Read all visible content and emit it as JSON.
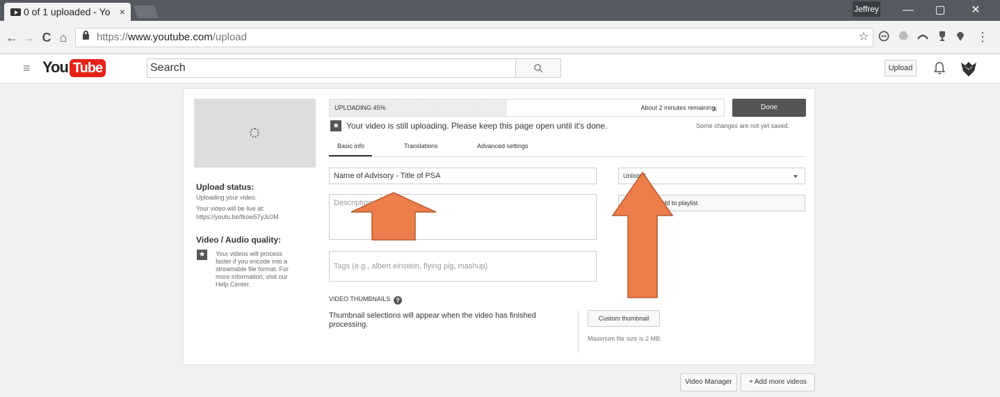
{
  "browser": {
    "tab_title": "0 of 1 uploaded - Yo",
    "tab_close": "×",
    "user_name": "Jeffrey",
    "url_prefix": "https://",
    "url_host": "www.youtube.com",
    "url_path": "/upload",
    "minimize": "—",
    "maximize": "▢",
    "close": "✕",
    "back": "←",
    "forward": "→",
    "reload": "C",
    "home": "⌂",
    "bookmark": "☆",
    "menu": "⋮"
  },
  "header": {
    "logo_you": "You",
    "logo_tube": "Tube",
    "search_value": "Search",
    "upload_label": "Upload"
  },
  "upload": {
    "progress_label": "UPLOADING 45%",
    "progress_fraction": 0.45,
    "remaining": "About 2 minutes remaining.",
    "cancel": "×",
    "done_label": "Done",
    "still_uploading": "Your video is still uploading. Please keep this page open until it's done.",
    "not_saved": "Some changes are not yet saved.",
    "tabs": [
      "Basic info",
      "Translations",
      "Advanced settings"
    ],
    "title_value": "Name of Advisory - Title of PSA",
    "privacy_value": "Unlisted",
    "description_placeholder": "Description",
    "playlist_label": "+ Add to playlist",
    "tags_placeholder": "Tags (e.g., albert einstein, flying pig, mashup)",
    "thumbnails_heading": "VIDEO THUMBNAILS",
    "thumbnails_help": "?",
    "thumbnails_text": "Thumbnail selections will appear when the video has finished processing.",
    "custom_thumbnail_label": "Custom thumbnail",
    "max_file_size": "Maximum file size is 2 MB."
  },
  "sidebar": {
    "status_heading": "Upload status:",
    "status_line1": "Uploading your video.",
    "status_line2": "Your video will be live at:",
    "status_link": "https://youtu.be/tkow57yJc0M",
    "quality_heading": "Video / Audio quality:",
    "quality_text": "Your videos will process faster if you encode into a streamable file format. For more information, visit our Help Center."
  },
  "footer": {
    "video_manager": "Video Manager",
    "add_more": "+ Add more videos"
  },
  "colors": {
    "arrow_fill": "#ed7d4b",
    "arrow_stroke": "#b2592e",
    "done_bg": "#555555",
    "logo_red": "#e62117"
  }
}
